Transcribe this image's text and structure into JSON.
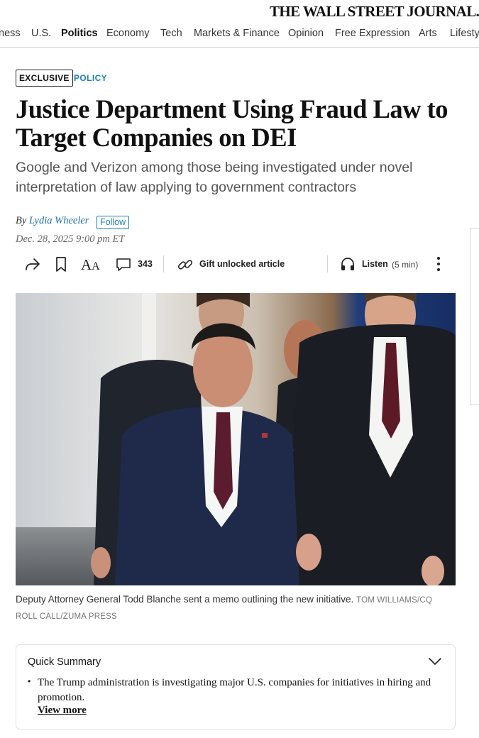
{
  "masthead": {
    "logo_text": "THE WALL STREET JOURNAL."
  },
  "nav": {
    "items": [
      {
        "label": "ness",
        "active": false
      },
      {
        "label": "U.S.",
        "active": false
      },
      {
        "label": "Politics",
        "active": true
      },
      {
        "label": "Economy",
        "active": false
      },
      {
        "label": "Tech",
        "active": false
      },
      {
        "label": "Markets & Finance",
        "active": false
      },
      {
        "label": "Opinion",
        "active": false
      },
      {
        "label": "Free Expression",
        "active": false
      },
      {
        "label": "Arts",
        "active": false
      },
      {
        "label": "Lifesty",
        "active": false
      }
    ]
  },
  "article": {
    "flag": "EXCLUSIVE",
    "category": "POLICY",
    "headline": "Justice Department Using Fraud Law to Target Companies on DEI",
    "dek": "Google and Verizon among those being investigated under novel interpretation of law applying to government contractors",
    "byline_prefix": "By ",
    "author": "Lydia Wheeler",
    "follow_label": "Follow",
    "date": "Dec. 28, 2025 9:00 pm ET"
  },
  "toolbar": {
    "share_icon": "share-icon",
    "bookmark_icon": "bookmark-icon",
    "font_small": "A",
    "font_big": "A",
    "comment_count": "343",
    "gift_label": "Gift unlocked article",
    "listen_label": "Listen",
    "listen_duration": "(5 min)"
  },
  "photo": {
    "caption": "Deputy Attorney General Todd Blanche sent a memo outlining the new initiative.",
    "credit": "TOM WILLIAMS/CQ ROLL CALL/ZUMA PRESS"
  },
  "summary": {
    "title": "Quick Summary",
    "bullet": "The Trump administration is investigating major U.S. companies for initiatives in hiring and promotion.",
    "view_more": "View more"
  },
  "colors": {
    "accent_blue": "#1b7fb5",
    "text_dark": "#111111",
    "text_muted": "#555555",
    "divider": "#cfcfcf"
  }
}
